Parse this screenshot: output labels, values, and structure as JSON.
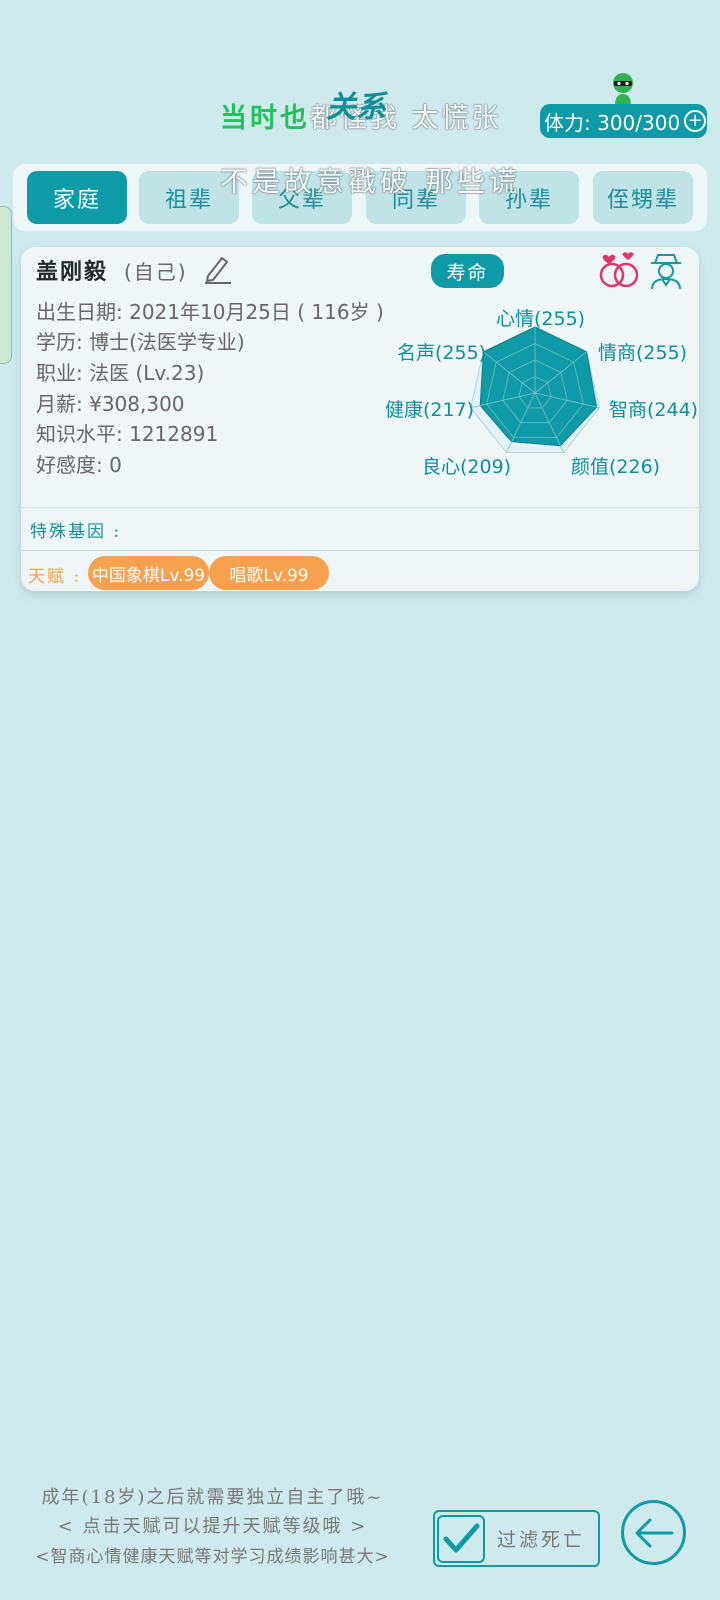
{
  "lyrics": {
    "line1_sung": "当时也",
    "line1_unsung": "都怪我 太慌张",
    "line1_deco": "关系",
    "line2": "不是故意戳破 那些谎"
  },
  "stamina": {
    "label": "体力: 300/300",
    "plus": "+"
  },
  "tabs": [
    {
      "label": "家庭",
      "active": true
    },
    {
      "label": "祖辈"
    },
    {
      "label": "父辈"
    },
    {
      "label": "同辈"
    },
    {
      "label": "孙辈"
    },
    {
      "label": "侄甥辈"
    }
  ],
  "person": {
    "name": "盖刚毅",
    "relation": "(自己)",
    "lifespan_button": "寿命",
    "birth": "出生日期: 2021年10月25日 ( 116岁 )",
    "education": "学历: 博士(法医学专业)",
    "job": "职业: 法医 (Lv.23)",
    "salary": "月薪: ¥308,300",
    "knowledge": "知识水平: 1212891",
    "favor": "好感度: 0"
  },
  "radar": {
    "max": 255,
    "stats": [
      {
        "label": "心情(255)",
        "value": 255
      },
      {
        "label": "情商(255)",
        "value": 255
      },
      {
        "label": "智商(244)",
        "value": 244
      },
      {
        "label": "颜值(226)",
        "value": 226
      },
      {
        "label": "良心(209)",
        "value": 209
      },
      {
        "label": "健康(217)",
        "value": 217
      },
      {
        "label": "名声(255)",
        "value": 255
      }
    ]
  },
  "genes": {
    "label": "特殊基因 :"
  },
  "talents": {
    "label": "天赋 :",
    "items": [
      "中国象棋Lv.99",
      "唱歌Lv.99"
    ]
  },
  "footer": {
    "tip1": "成年(18岁)之后就需要独立自主了哦~",
    "tip2": "< 点击天赋可以提升天赋等级哦 >",
    "tip3": "<智商心情健康天赋等对学习成绩影响甚大>",
    "filter_label": "过滤死亡",
    "filter_checked": true
  },
  "colors": {
    "accent": "#0e9aa7",
    "background": "#cfeaed",
    "talent": "#f7a04e"
  }
}
